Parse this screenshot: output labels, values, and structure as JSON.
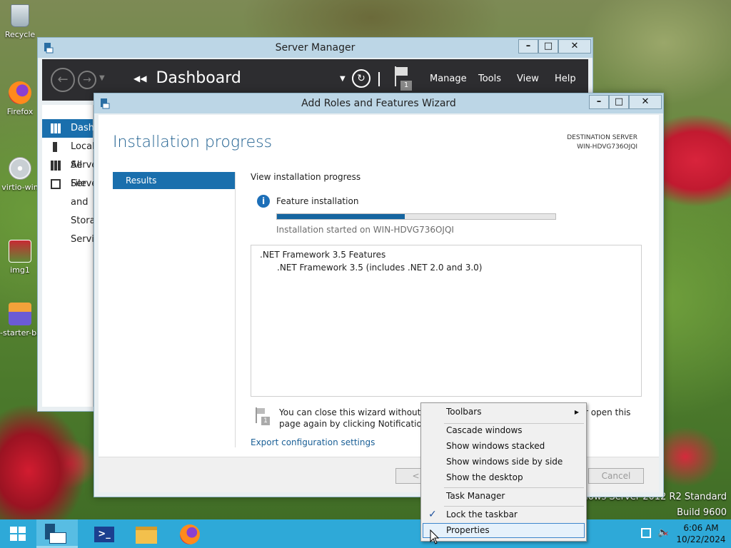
{
  "colors": {
    "accent": "#1a6fad",
    "titlebar": "#bcd6e6",
    "taskbar": "#2ea9d8",
    "progress": "#1565a0"
  },
  "desktop": {
    "icons": [
      {
        "label": "Recycle",
        "icon": "recycle-bin-icon"
      },
      {
        "label": "Firefox",
        "icon": "firefox-icon"
      },
      {
        "label": "virtio-win",
        "icon": "disc-icon"
      },
      {
        "label": "img1",
        "icon": "image-file-icon"
      },
      {
        "label": "-starter-ba",
        "icon": "installer-icon"
      }
    ],
    "watermark": {
      "line1": "Windows Server 2012 R2 Standard",
      "line2": "Build 9600"
    }
  },
  "server_manager": {
    "title": "Server Manager",
    "breadcrumb": "Dashboard",
    "notification_count": "1",
    "menu": [
      "Manage",
      "Tools",
      "View",
      "Help"
    ],
    "nav": [
      {
        "label": "Dashboard",
        "icon": "dashboard-icon"
      },
      {
        "label": "Local Server",
        "icon": "server-icon"
      },
      {
        "label": "All Servers",
        "icon": "servers-icon"
      },
      {
        "label": "File and Storage Services",
        "icon": "file-storage-icon"
      }
    ]
  },
  "wizard": {
    "title": "Add Roles and Features Wizard",
    "heading": "Installation progress",
    "destination_label": "DESTINATION SERVER",
    "destination_value": "WIN-HDVG736OJQI",
    "steps": [
      "Results"
    ],
    "view_label": "View installation progress",
    "status_label": "Feature installation",
    "progress": 0.46,
    "started_text": "Installation started on WIN-HDVG736OJQI",
    "features": [
      ".NET Framework 3.5 Features",
      ".NET Framework 3.5 (includes .NET 2.0 and 3.0)"
    ],
    "notice_left1": "You can close this wizard without inte",
    "notice_right1": "r open this",
    "notice_left2": "page again by clicking Notifications in",
    "export_link": "Export configuration settings",
    "buttons": {
      "previous": "< Pre",
      "cancel": "Cancel"
    }
  },
  "context_menu": {
    "items": [
      {
        "label": "Toolbars",
        "submenu": true
      },
      {
        "label": "Cascade windows"
      },
      {
        "label": "Show windows stacked"
      },
      {
        "label": "Show windows side by side"
      },
      {
        "label": "Show the desktop"
      },
      {
        "label": "Task Manager"
      },
      {
        "label": "Lock the taskbar",
        "checked": true
      },
      {
        "label": "Properties",
        "highlighted": true
      }
    ]
  },
  "taskbar": {
    "buttons": [
      "start-icon",
      "server-manager-icon",
      "powershell-icon",
      "file-explorer-icon",
      "firefox-icon"
    ],
    "time": "6:06 AM",
    "date": "10/22/2024"
  }
}
